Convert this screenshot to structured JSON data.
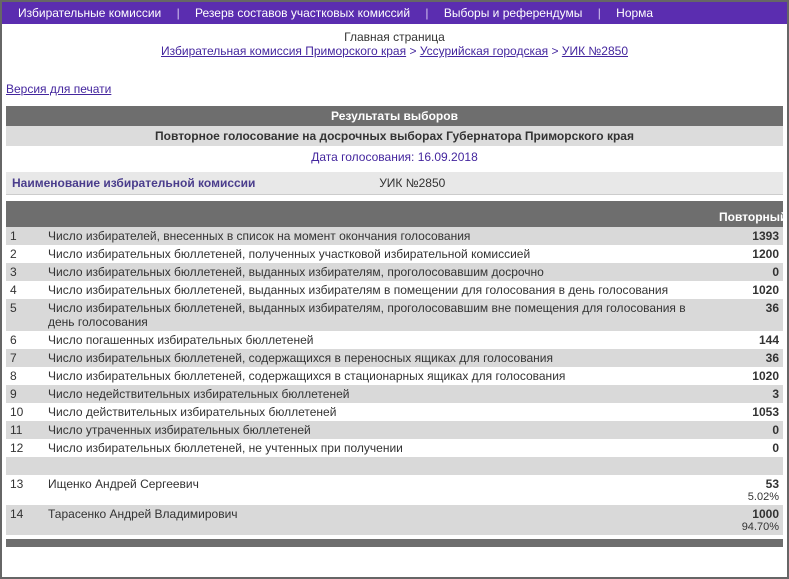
{
  "nav": {
    "items": [
      "Избирательные комиссии",
      "Резерв составов участковых комиссий",
      "Выборы и референдумы",
      "Норма"
    ]
  },
  "header": {
    "main_page": "Главная страница",
    "breadcrumb": [
      "Избирательная комиссия Приморского края",
      "Уссурийская городская",
      "УИК №2850"
    ],
    "sep": ">"
  },
  "print_link": "Версия для печати",
  "titles": {
    "results": "Результаты выборов",
    "event": "Повторное голосование на досрочных выборах Губернатора Приморского края",
    "date_label": "Дата голосования:  16.09.2018"
  },
  "commission": {
    "label": "Наименование избирательной комиссии",
    "value": "УИК №2850"
  },
  "table": {
    "header_right": "Повторный",
    "rows": [
      {
        "n": "1",
        "desc": "Число избирателей, внесенных в список на момент окончания голосования",
        "val": "1393"
      },
      {
        "n": "2",
        "desc": "Число избирательных бюллетеней, полученных участковой избирательной комиссией",
        "val": "1200"
      },
      {
        "n": "3",
        "desc": "Число избирательных бюллетеней, выданных избирателям, проголосовавшим досрочно",
        "val": "0"
      },
      {
        "n": "4",
        "desc": "Число избирательных бюллетеней, выданных избирателям в помещении для голосования в день голосования",
        "val": "1020"
      },
      {
        "n": "5",
        "desc": "Число избирательных бюллетеней, выданных избирателям, проголосовавшим вне помещения для голосования в день голосования",
        "val": "36"
      },
      {
        "n": "6",
        "desc": "Число погашенных избирательных бюллетеней",
        "val": "144"
      },
      {
        "n": "7",
        "desc": "Число избирательных бюллетеней, содержащихся в переносных ящиках для голосования",
        "val": "36"
      },
      {
        "n": "8",
        "desc": "Число избирательных бюллетеней, содержащихся в стационарных ящиках для голосования",
        "val": "1020"
      },
      {
        "n": "9",
        "desc": "Число недействительных избирательных бюллетеней",
        "val": "3"
      },
      {
        "n": "10",
        "desc": "Число действительных избирательных бюллетеней",
        "val": "1053"
      },
      {
        "n": "11",
        "desc": "Число утраченных избирательных бюллетеней",
        "val": "0"
      },
      {
        "n": "12",
        "desc": "Число избирательных бюллетеней, не учтенных при получении",
        "val": "0"
      }
    ],
    "candidates": [
      {
        "n": "13",
        "desc": "Ищенко Андрей Сергеевич",
        "val": "53",
        "pct": "5.02%"
      },
      {
        "n": "14",
        "desc": "Тарасенко Андрей Владимирович",
        "val": "1000",
        "pct": "94.70%"
      }
    ]
  }
}
